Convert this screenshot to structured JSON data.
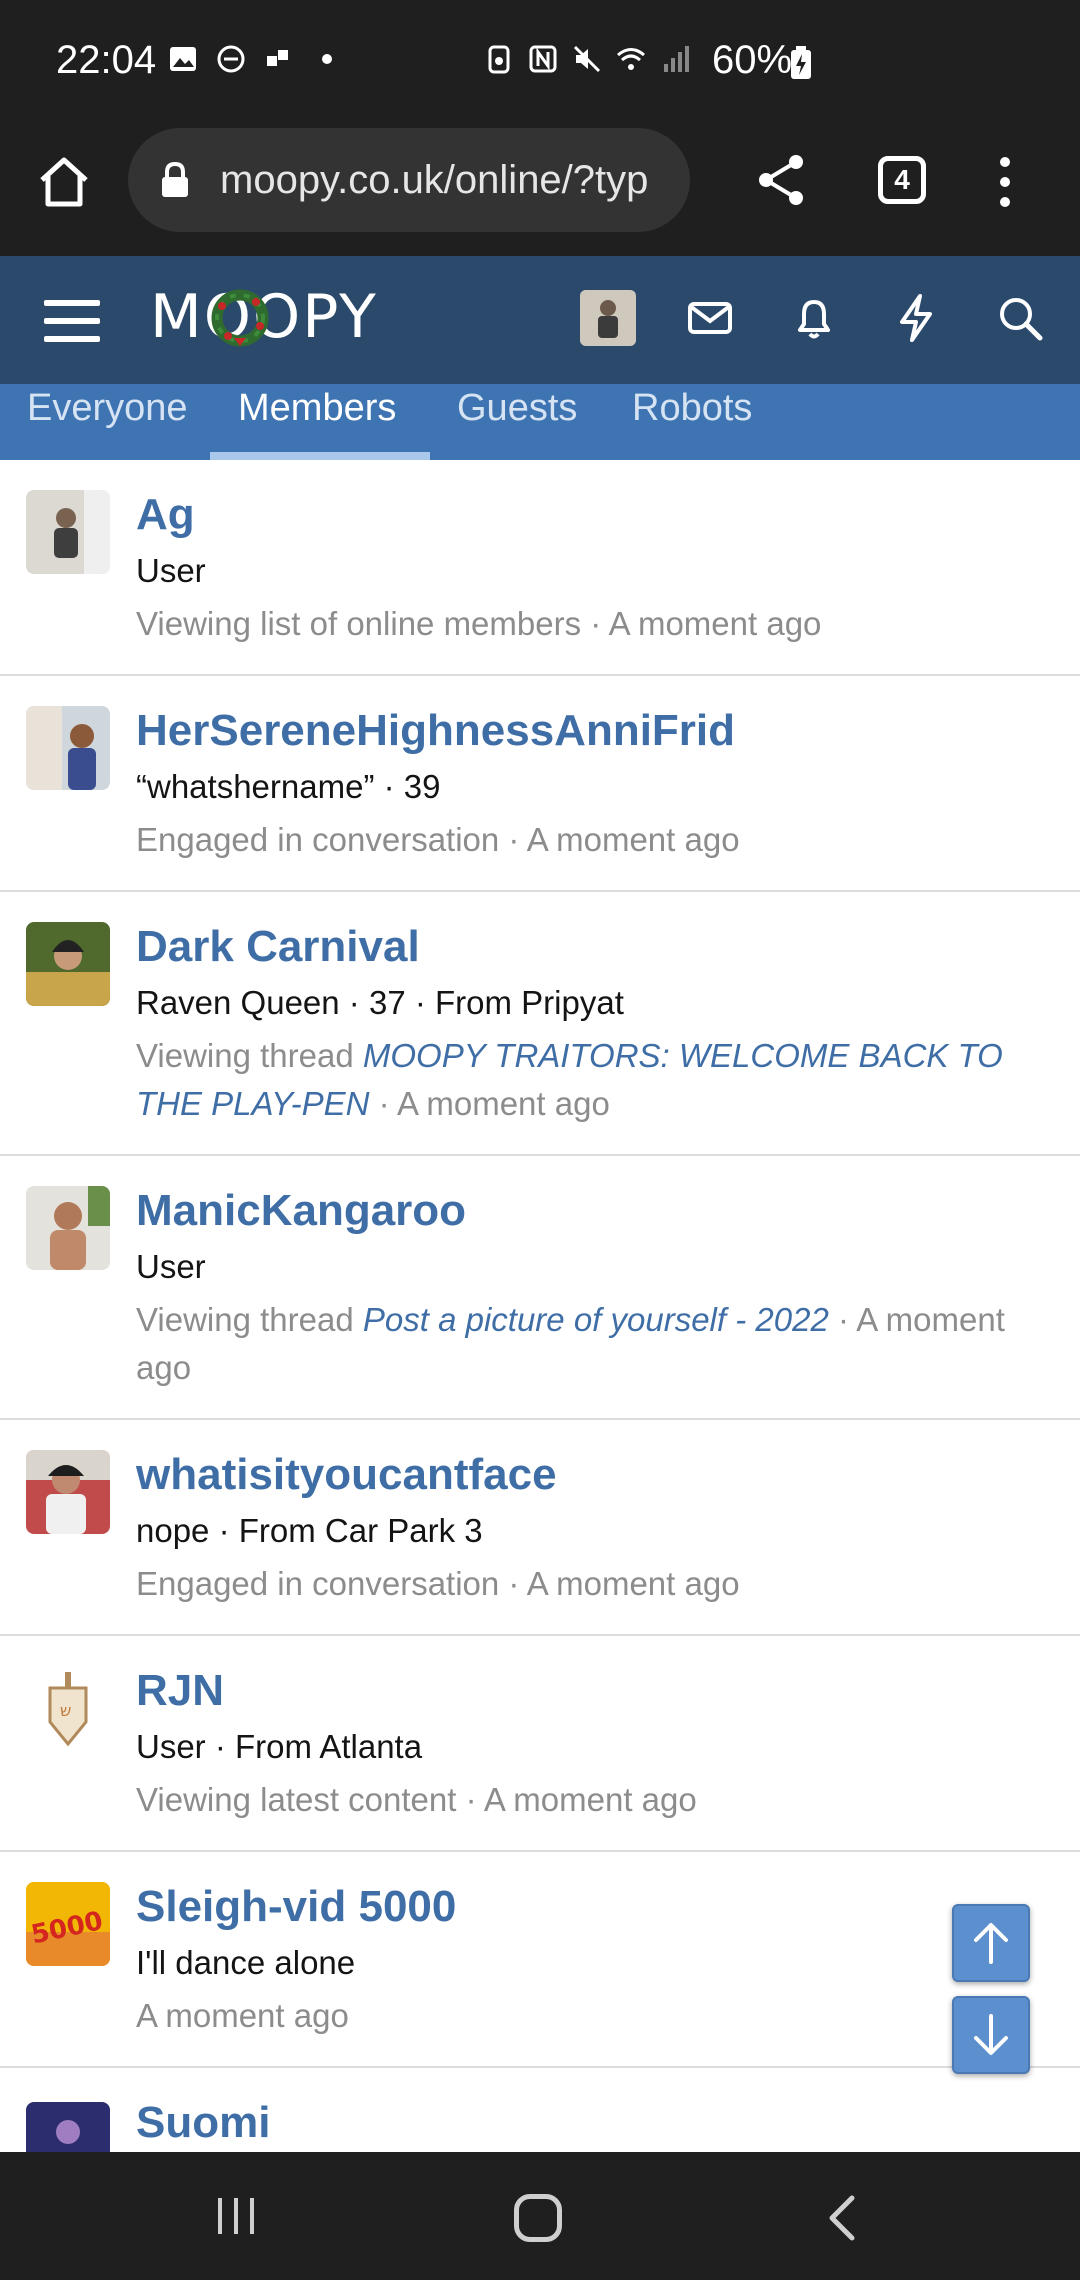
{
  "status_bar": {
    "time": "22:04",
    "battery": "60%",
    "left_icons": [
      "gallery-icon",
      "dnd-icon",
      "app-icon",
      "dot-icon"
    ],
    "right_icons": [
      "saver-icon",
      "nfc-icon",
      "mute-icon",
      "wifi-icon",
      "signal-icon"
    ]
  },
  "browser": {
    "url": "moopy.co.uk/online/?typ",
    "tab_count": "4"
  },
  "site": {
    "logo": "MOOPY"
  },
  "tabs": [
    {
      "label": "Everyone",
      "active": false
    },
    {
      "label": "Members",
      "active": true
    },
    {
      "label": "Guests",
      "active": false
    },
    {
      "label": "Robots",
      "active": false
    }
  ],
  "members": [
    {
      "name": "Ag",
      "info": "User",
      "activity": "Viewing list of online members · A moment ago"
    },
    {
      "name": "HerSereneHighnessAnniFrid",
      "info": "“whatshername” · 39",
      "activity": "Engaged in conversation · A moment ago"
    },
    {
      "name": "Dark Carnival",
      "info": "Raven Queen · 37 · From Pripyat",
      "activity_prefix": "Viewing thread ",
      "activity_link": "MOOPY TRAITORS: WELCOME BACK TO THE PLAY-PEN",
      "activity_suffix": " · A moment ago"
    },
    {
      "name": "ManicKangaroo",
      "info": "User",
      "activity_prefix": "Viewing thread ",
      "activity_link": "Post a picture of yourself - 2022",
      "activity_suffix": " · A moment ago"
    },
    {
      "name": "whatisityoucantface",
      "info": "nope · From Car Park 3",
      "activity": "Engaged in conversation · A moment ago"
    },
    {
      "name": "RJN",
      "info": "User · From Atlanta",
      "activity": "Viewing latest content · A moment ago"
    },
    {
      "name": "Sleigh-vid 5000",
      "info": "I'll dance alone",
      "activity": "A moment ago",
      "avatar_text": "5000"
    },
    {
      "name": "Suomi"
    }
  ],
  "colors": {
    "header_bg": "#2b4a6b",
    "tabbar_bg": "#3f74b3",
    "link": "#3f6ea6",
    "system_bar": "#1f1f1f"
  }
}
